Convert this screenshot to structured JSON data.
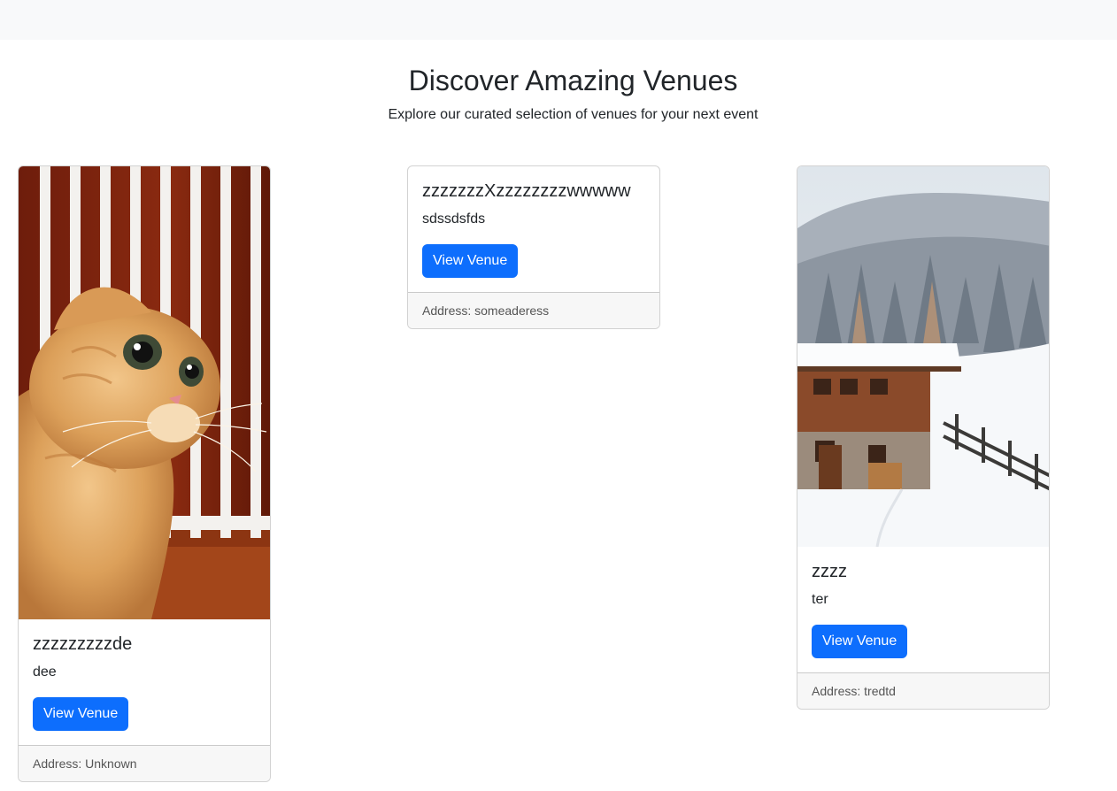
{
  "header": {
    "title": "Discover Amazing Venues",
    "subtitle": "Explore our curated selection of venues for your next event"
  },
  "venues": [
    {
      "name": "zzzzzzzzzde",
      "description": "dee",
      "button_label": "View Venue",
      "address": "Address: Unknown",
      "image": "cat-photo"
    },
    {
      "name": "zzzzzzzXzzzzzzzzwwwww",
      "description": "sdssdsfds",
      "button_label": "View Venue",
      "address": "Address: someaderess",
      "image": ""
    },
    {
      "name": "zzzz",
      "description": "ter",
      "button_label": "View Venue",
      "address": "Address: tredtd",
      "image": "snowy-cabin-photo"
    }
  ],
  "colors": {
    "primary": "#0d6efd",
    "navbar_bg": "#f8f9fa",
    "footer_bg": "#f7f7f7"
  }
}
